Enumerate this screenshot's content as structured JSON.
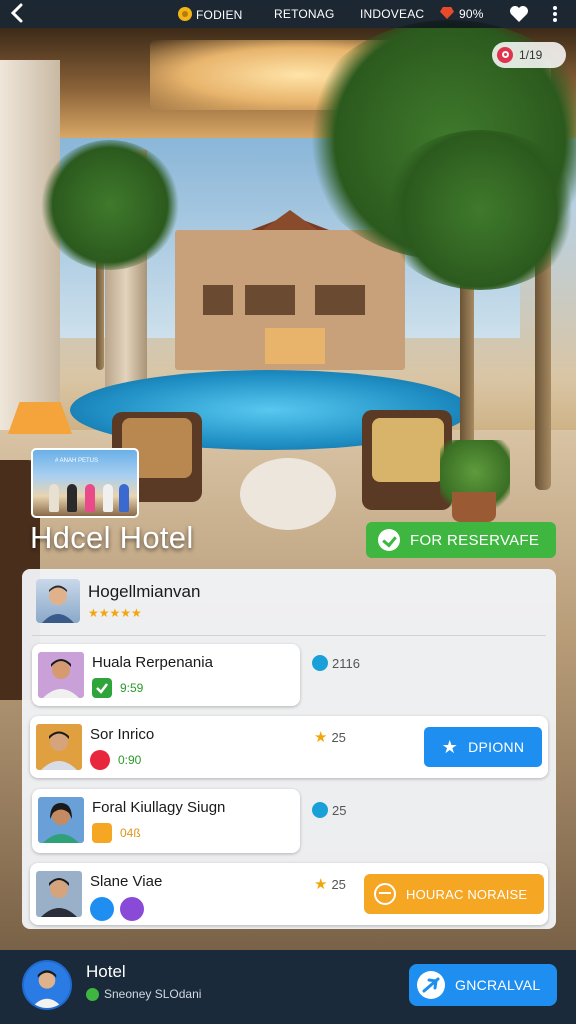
{
  "topbar": {
    "item1": "FODIEN",
    "item2": "RETONAG",
    "item3": "INDOVEAC",
    "item4": "90%"
  },
  "photo_counter": "1/19",
  "thumbnail_caption": "# ANAH PETUS",
  "hotel": {
    "title": "Hdcel Hotel",
    "reserve_label": "FOR RESERVAFE"
  },
  "panel": {
    "header_name": "Hogellmianvan",
    "header_stars": "★★★★★",
    "rows": [
      {
        "name": "Huala Rerpenania",
        "sub": "9:59",
        "stat": "2116"
      },
      {
        "name": "Sor Inrico",
        "sub": "0:90",
        "stat": "25",
        "button": "DPIONN"
      },
      {
        "name": "Foral Kiullagy Siugn",
        "sub": "04ß",
        "stat": "25"
      },
      {
        "name": "Slane Viae",
        "stat": "25",
        "button": "HOURAC NORAISE"
      }
    ]
  },
  "bottom": {
    "title": "Hotel",
    "subtitle": "Sneoney SLOdani",
    "button": "GNCRALVAL"
  },
  "colors": {
    "accent_green": "#3fb640",
    "accent_blue": "#1e8ff0",
    "accent_orange": "#f5a623",
    "bottom_bar": "#1b2a3a"
  },
  "icons": [
    "back-arrow-icon",
    "coin-icon",
    "gem-icon",
    "heart-icon",
    "more-icon",
    "camera-icon",
    "check-icon",
    "star-icon",
    "plane-icon"
  ]
}
